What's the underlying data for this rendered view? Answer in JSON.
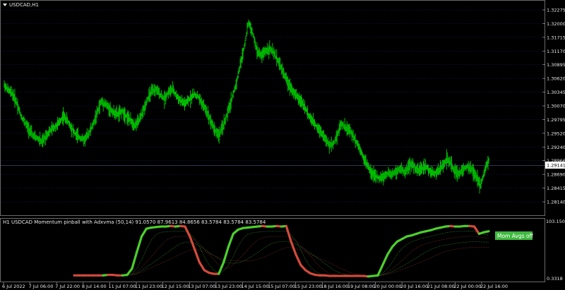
{
  "window": {
    "symbol_label": "USDCAD,H1",
    "menu_arrow": "dropdown-triangle"
  },
  "price_chart": {
    "price_axis_labels": [
      "1.32275",
      "1.32000",
      "1.31715",
      "1.31170",
      "1.30895",
      "1.30620",
      "1.30345",
      "1.30070",
      "1.29795",
      "1.29520",
      "1.29240",
      "1.28966",
      "1.28690",
      "1.28415",
      "1.28140"
    ],
    "current_price": "1.29141",
    "bar_color": "#00cc00",
    "grid_color": "#1c2b6b"
  },
  "indicator": {
    "title": "H1 USDCAD Momentum pinball with Adxvma (50,14) 91.0570 87.9613 84.8656 83.5784 83.5784 83.5784",
    "top_value": "103.1504",
    "bottom_value": "0.3318",
    "badge_text": "Mom Avgs off",
    "badge_color": "#3fb93f",
    "up_color": "#4cd02c",
    "down_color": "#d44a3a",
    "flat_color": "#bfbfbf"
  },
  "time_axis_labels": [
    "6 Jul 2022",
    "7 Jul 06:00",
    "7 Jul 22:00",
    "8 Jul 14:00",
    "11 Jul 07:00",
    "11 Jul 23:00",
    "12 Jul 15:00",
    "13 Jul 07:00",
    "13 Jul 23:00",
    "14 Jul 15:00",
    "15 Jul 07:00",
    "15 Jul 23:00",
    "18 Jul 16:00",
    "19 Jul 08:00",
    "20 Jul 00:00",
    "20 Jul 16:00",
    "21 Jul 08:00",
    "22 Jul 00:00",
    "22 Jul 16:00"
  ],
  "chart_data": {
    "type": "line",
    "title": "USDCAD,H1",
    "price_series": [
      1.3069,
      1.3058,
      1.305,
      1.3032,
      1.3005,
      1.299,
      1.2975,
      1.2962,
      1.2958,
      1.295,
      1.2965,
      1.2975,
      1.2982,
      1.299,
      1.3005,
      1.2995,
      1.298,
      1.2965,
      1.296,
      1.2955,
      1.2968,
      1.2985,
      1.301,
      1.3035,
      1.303,
      1.302,
      1.3012,
      1.3008,
      1.3015,
      1.3005,
      1.2995,
      1.2985,
      1.2995,
      1.3015,
      1.304,
      1.3055,
      1.306,
      1.305,
      1.304,
      1.3055,
      1.306,
      1.3045,
      1.3035,
      1.303,
      1.304,
      1.305,
      1.3045,
      1.303,
      1.3015,
      1.2995,
      1.2975,
      1.2965,
      1.2985,
      1.301,
      1.304,
      1.307,
      1.311,
      1.315,
      1.32,
      1.3175,
      1.314,
      1.313,
      1.314,
      1.3145,
      1.3135,
      1.312,
      1.31,
      1.308,
      1.3065,
      1.305,
      1.304,
      1.303,
      1.301,
      1.2995,
      1.2985,
      1.2975,
      1.296,
      1.2945,
      1.2945,
      1.2965,
      1.299,
      1.298,
      1.2975,
      1.296,
      1.2945,
      1.2925,
      1.2905,
      1.289,
      1.288,
      1.2875,
      1.2878,
      1.2885,
      1.2883,
      1.289,
      1.2895,
      1.2888,
      1.29,
      1.2905,
      1.289,
      1.2895,
      1.29,
      1.289,
      1.2885,
      1.289,
      1.29,
      1.2915,
      1.2905,
      1.289,
      1.2885,
      1.2895,
      1.29,
      1.2893,
      1.288,
      1.286,
      1.2888,
      1.2915
    ],
    "indicator_series": [
      {
        "values": [
          5,
          5,
          5,
          5,
          5,
          5,
          5,
          6,
          6,
          5,
          5,
          6,
          18,
          50,
          80,
          95,
          97,
          98,
          99,
          99,
          100,
          99,
          100,
          99,
          80,
          55,
          30,
          15,
          10,
          8,
          8,
          30,
          60,
          85,
          93,
          96,
          97,
          98,
          99,
          100,
          99,
          99,
          100,
          99,
          100,
          70,
          45,
          25,
          15,
          9,
          6,
          5,
          5,
          4,
          4,
          4,
          4,
          4,
          4,
          4,
          4,
          3,
          4,
          5,
          25,
          45,
          60,
          70,
          75,
          80,
          82,
          85,
          88,
          90,
          92,
          95,
          97,
          99,
          100,
          99,
          99,
          100,
          100,
          99,
          85,
          88,
          90
        ]
      }
    ],
    "ylim_price": [
      1.28,
      1.324
    ],
    "ylim_indicator": [
      0,
      103.1504
    ]
  }
}
